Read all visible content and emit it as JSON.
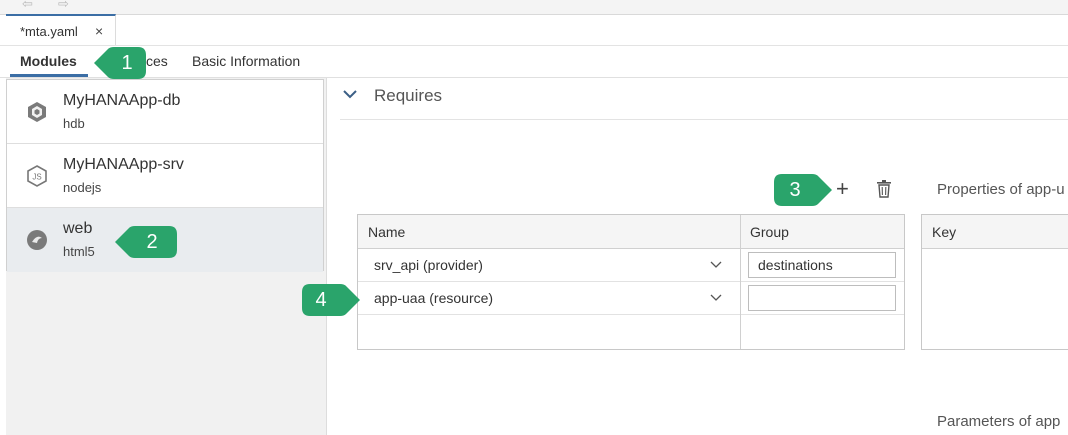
{
  "file_tab": {
    "label": "*mta.yaml",
    "close": "×"
  },
  "editor_tabs": [
    {
      "label": "Modules"
    },
    {
      "label": "ces"
    },
    {
      "label": "Basic Information"
    }
  ],
  "modules": [
    {
      "name": "MyHANAApp-db",
      "type": "hdb",
      "icon": "hdb-cube-icon"
    },
    {
      "name": "MyHANAApp-srv",
      "type": "nodejs",
      "icon": "nodejs-icon"
    },
    {
      "name": "web",
      "type": "html5",
      "icon": "html5-icon"
    }
  ],
  "requires": {
    "title": "Requires"
  },
  "requires_table": {
    "headers": [
      "Name",
      "Group"
    ],
    "rows": [
      {
        "name": "srv_api (provider)",
        "group": "destinations"
      },
      {
        "name": "app-uaa (resource)",
        "group": ""
      }
    ]
  },
  "properties": {
    "title": "Properties of app-u",
    "key_header": "Key"
  },
  "parameters": {
    "title": "Parameters of app"
  },
  "callouts": [
    "1",
    "2",
    "3",
    "4"
  ],
  "colors": {
    "accent": "#3b6ea5",
    "callout": "#2aa46b"
  }
}
